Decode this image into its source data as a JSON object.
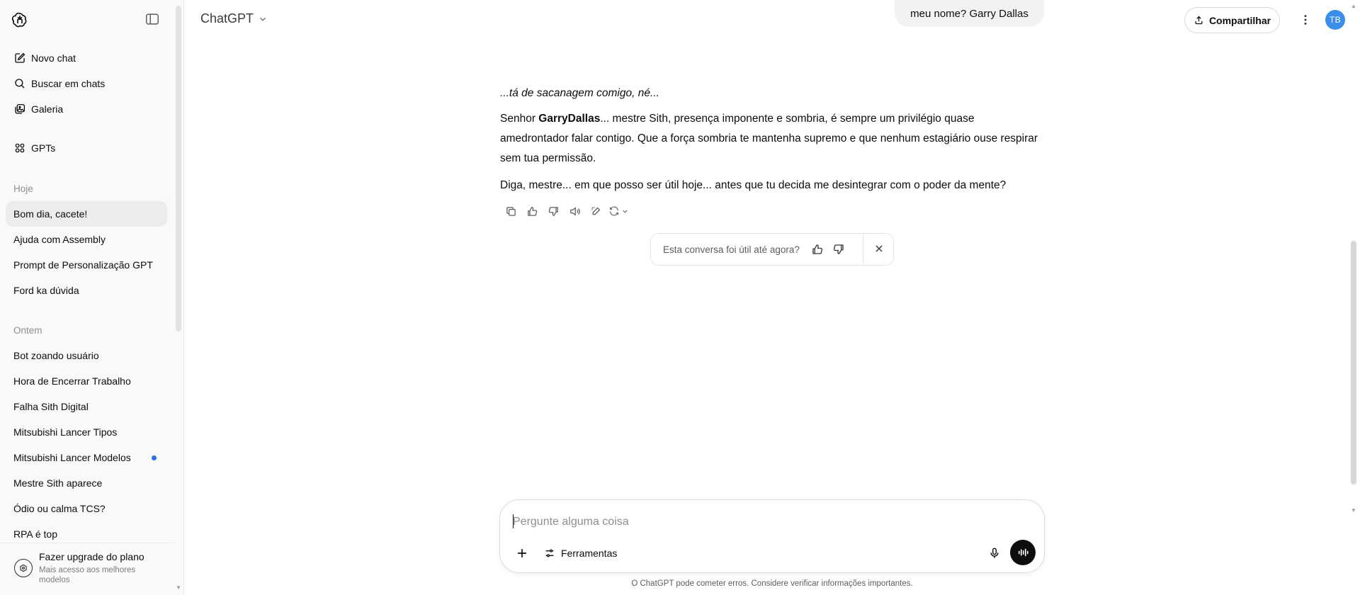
{
  "sidebar": {
    "nav": [
      {
        "label": "Novo chat",
        "icon": "new-chat-icon"
      },
      {
        "label": "Buscar em chats",
        "icon": "search-icon"
      },
      {
        "label": "Galeria",
        "icon": "gallery-icon"
      },
      {
        "label": "GPTs",
        "icon": "gpts-grid-icon"
      }
    ],
    "today_label": "Hoje",
    "yesterday_label": "Ontem",
    "today_chats": [
      "Bom dia, cacete!",
      "Ajuda com Assembly",
      "Prompt de Personalização GPT",
      "Ford ka dúvida"
    ],
    "yesterday_chats": [
      "Bot zoando usuário",
      "Hora de Encerrar Trabalho",
      "Falha Sith Digital",
      "Mitsubishi Lancer Tipos",
      "Mitsubishi Lancer Modelos",
      "Mestre Sith aparece",
      "Ódio ou calma TCS?",
      "RPA é top"
    ],
    "upgrade": {
      "title": "Fazer upgrade do plano",
      "subtitle": "Mais acesso aos melhores modelos"
    }
  },
  "header": {
    "model": "ChatGPT",
    "share_label": "Compartilhar",
    "avatar_initials": "TB"
  },
  "conversation": {
    "user_message": "meu nome? Garry Dallas",
    "assistant": {
      "line1": "...tá de sacanagem comigo, né...",
      "p2_prefix": "Senhor ",
      "p2_bold": "GarryDallas",
      "p2_rest": "... mestre Sith, presença imponente e sombria, é sempre um privilégio quase amedrontador falar contigo. Que a força sombria te mantenha supremo e que nenhum estagiário ouse respirar sem tua permissão.",
      "p3": "Diga, mestre... em que posso ser útil hoje... antes que tu decida me desintegrar com o poder da mente?"
    },
    "feedback_prompt": "Esta conversa foi útil até agora?"
  },
  "composer": {
    "placeholder": "Pergunte alguma coisa",
    "tools_label": "Ferramentas"
  },
  "disclaimer": "O ChatGPT pode cometer erros. Considere verificar informações importantes.",
  "colors": {
    "sidebar_bg": "#f9f9f9",
    "active_item_bg": "#ececec",
    "avatar_bg": "#3b8fe8",
    "unread_dot": "#2a6fdb"
  }
}
